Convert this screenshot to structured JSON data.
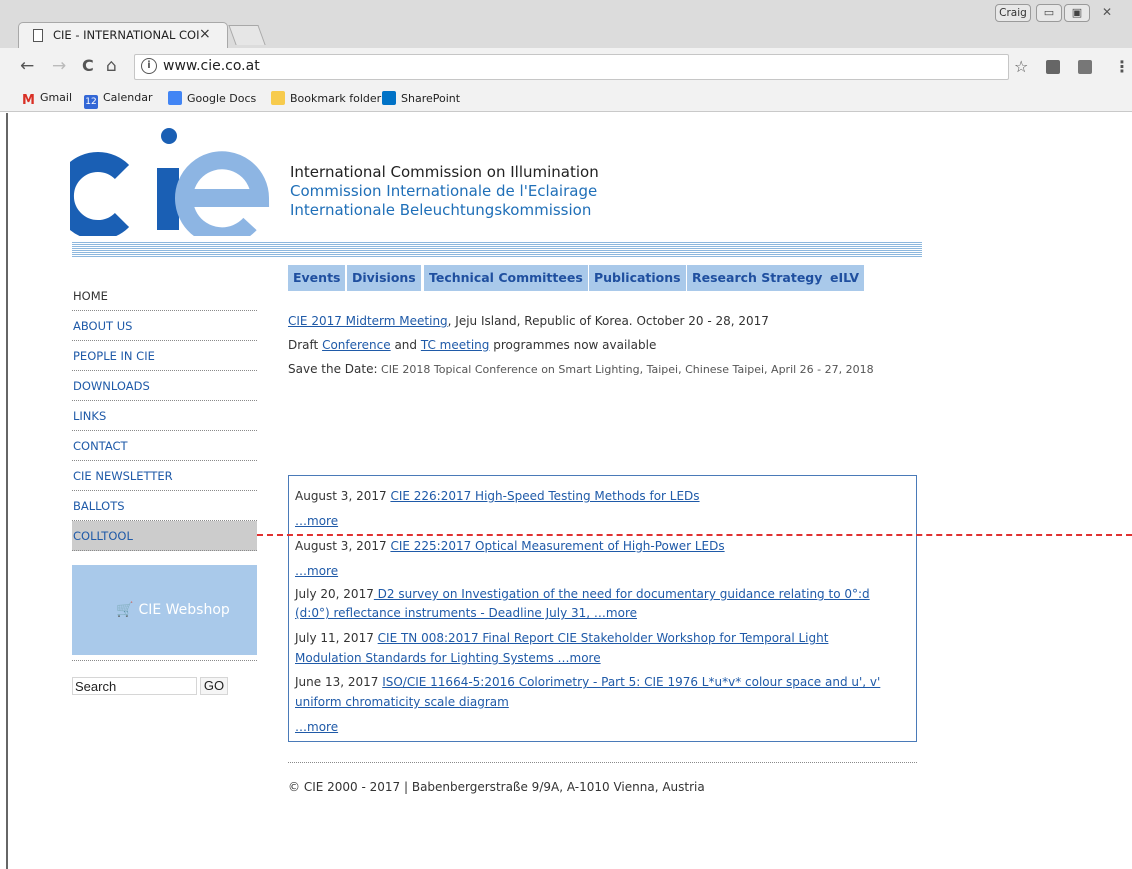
{
  "browser": {
    "tab_title": "CIE - INTERNATIONAL COI",
    "tab_close": "×",
    "profile": "Craig",
    "window_minimize": "▭",
    "window_maximize": "▣",
    "window_close": "✕",
    "url": "www.cie.co.at",
    "back": "←",
    "forward": "→",
    "reload": "C",
    "home": "⌂",
    "bookmark_star": "☆",
    "menu": "⋮",
    "bookmarks": [
      {
        "label": "Gmail",
        "icon": "gmail-icon",
        "color": "#d93025"
      },
      {
        "label": "Calendar",
        "icon": "calendar-icon",
        "color": "#3367d6",
        "badge": "12"
      },
      {
        "label": "Google Docs",
        "icon": "docs-icon",
        "color": "#4285f4"
      },
      {
        "label": "Bookmark folder",
        "icon": "folder-icon",
        "color": "#f7cb4d"
      },
      {
        "label": "SharePoint",
        "icon": "sharepoint-icon",
        "color": "#0072c6"
      }
    ]
  },
  "site": {
    "org_names": [
      "International Commission on Illumination",
      "Commission Internationale de l'Eclairage",
      "Internationale Beleuchtungskommission"
    ],
    "side_nav": [
      "HOME",
      "ABOUT US",
      "PEOPLE IN CIE",
      "DOWNLOADS",
      "LINKS",
      "CONTACT",
      "CIE NEWSLETTER",
      "BALLOTS",
      "COLLTOOL"
    ],
    "active_side_item": "COLLTOOL",
    "webshop_label": "CIE Webshop",
    "search_value": "Search",
    "search_button": "GO",
    "top_nav": [
      "Events",
      "Divisions",
      "Technical Committees",
      "Publications",
      "Research Strategy",
      "eILV"
    ],
    "announcements": {
      "meeting_link": "CIE 2017 Midterm Meeting",
      "meeting_rest": ", Jeju Island, Republic of Korea. October 20 - 28, 2017",
      "draft_pre": "Draft ",
      "conference_link": "Conference",
      "and": " and ",
      "tc_link": "TC meeting",
      "programmes": " programmes now available",
      "save_date_label": "Save the Date:",
      "save_date_text": " CIE 2018 Topical Conference on Smart Lighting, Taipei, Chinese Taipei, April 26 - 27, 2018"
    },
    "news": [
      {
        "date": "August 3, 2017 ",
        "title": "CIE 226:2017 High-Speed Testing Methods for LEDs",
        "more": "…more"
      },
      {
        "date": "August 3, 2017 ",
        "title": "CIE 225:2017 Optical Measurement of High-Power LEDs",
        "more": "…more"
      },
      {
        "date": "July 20, 2017",
        "title_line1": " D2 survey on Investigation of the need for documentary guidance relating to 0°:d",
        "title_line2": "(d:0°) reflectance instruments - Deadline July 31, …more"
      },
      {
        "date": "July 11, 2017 ",
        "title_line1": "CIE TN 008:2017 Final Report CIE Stakeholder Workshop for Temporal Light",
        "title_line2": "Modulation Standards for Lighting Systems …more"
      },
      {
        "date": "June 13, 2017 ",
        "title_line1": "ISO/CIE 11664-5:2016 Colorimetry - Part 5: CIE 1976 L*u*v* colour space and u', v'",
        "title_line2": "uniform chromaticity scale diagram"
      }
    ],
    "news_more": "…more",
    "footer": "© CIE 2000 - 2017 | Babenbergerstraße 9/9A, A-1010 Vienna, Austria"
  }
}
